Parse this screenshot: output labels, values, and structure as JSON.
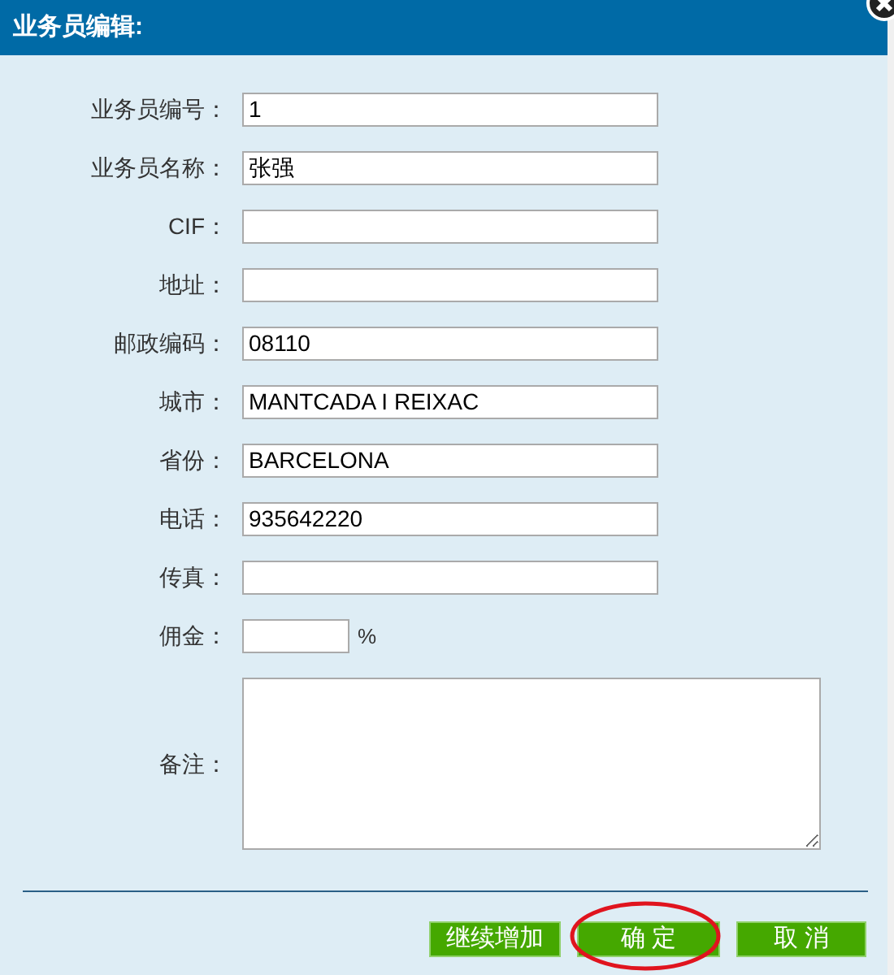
{
  "window": {
    "title": "业务员编辑:"
  },
  "fields": [
    {
      "kind": "text",
      "label": "业务员编号：",
      "value": "1"
    },
    {
      "kind": "text",
      "label": "业务员名称：",
      "value": "张强"
    },
    {
      "kind": "text",
      "label": "CIF："
    },
    {
      "kind": "text",
      "label": "地址："
    },
    {
      "kind": "text",
      "label": "邮政编码：",
      "value": "08110"
    },
    {
      "kind": "text",
      "label": "城市：",
      "value": "MANTCADA I REIXAC"
    },
    {
      "kind": "text",
      "label": "省份：",
      "value": "BARCELONA"
    },
    {
      "kind": "text",
      "label": "电话：",
      "value": "935642220"
    },
    {
      "kind": "text",
      "label": "传真："
    },
    {
      "kind": "percent",
      "label": "佣金：",
      "suffix": "%"
    },
    {
      "kind": "textarea",
      "label": "备注："
    }
  ],
  "buttons": [
    {
      "label": "继续增加",
      "circled": false
    },
    {
      "label": "确 定",
      "circled": true
    },
    {
      "label": "取 消",
      "circled": false
    }
  ]
}
